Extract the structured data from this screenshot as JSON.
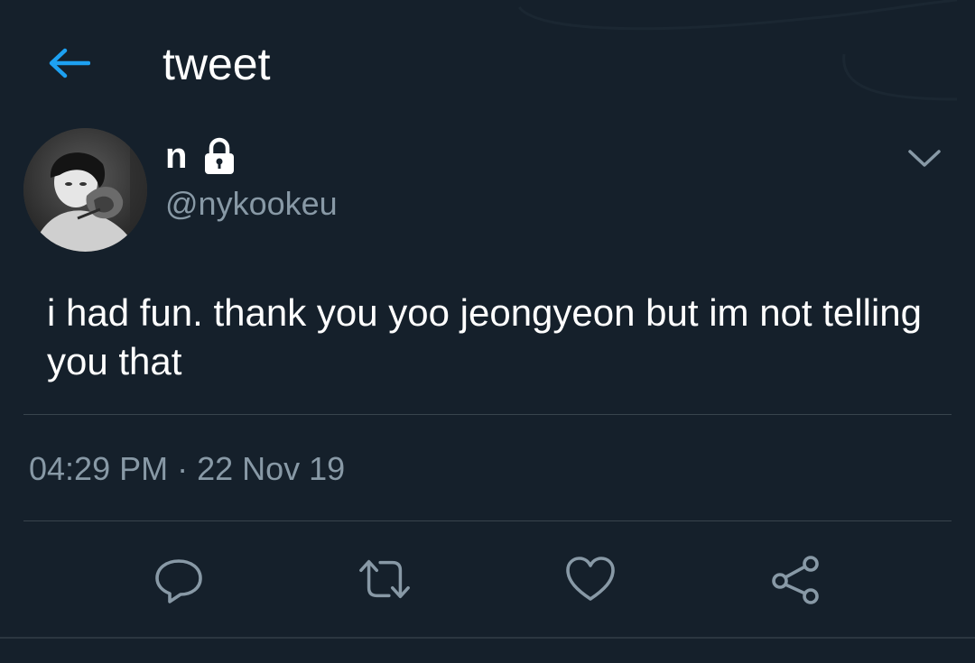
{
  "header": {
    "title": "tweet",
    "back_icon": "back-arrow-icon"
  },
  "tweet": {
    "display_name": "n",
    "protected_icon": "lock-icon",
    "handle": "@nykookeu",
    "text": "i had fun. thank you yoo jeongyeon but im not telling you that",
    "timestamp": "04:29 PM · 22 Nov 19",
    "more_icon": "chevron-down-icon"
  },
  "actions": [
    {
      "icon": "reply-icon"
    },
    {
      "icon": "retweet-icon"
    },
    {
      "icon": "like-icon"
    },
    {
      "icon": "share-icon"
    }
  ],
  "colors": {
    "background": "#15202b",
    "accent": "#1da1f2",
    "secondary_text": "#8899a6",
    "divider": "#38444d"
  }
}
